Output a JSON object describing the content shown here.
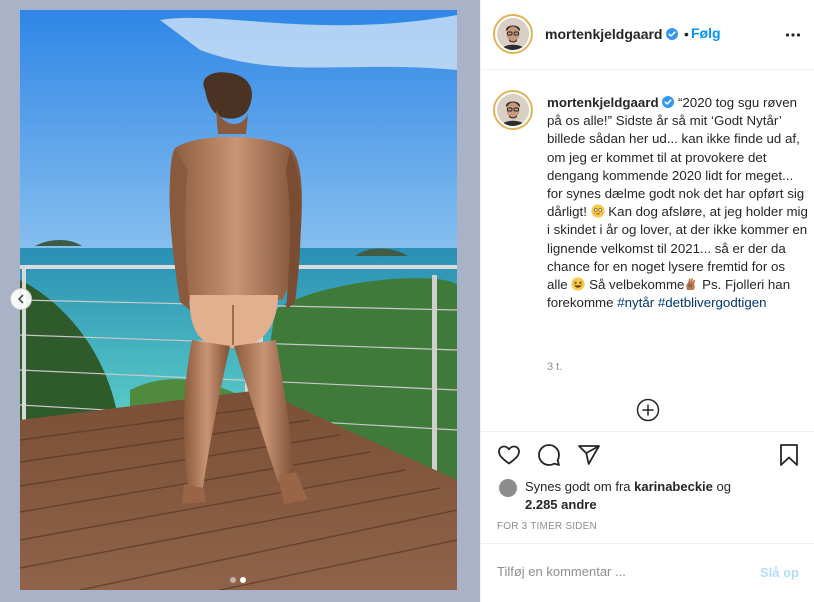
{
  "media": {
    "dots": [
      {
        "active": false
      },
      {
        "active": true
      }
    ],
    "prev_icon": "chevron-left-icon"
  },
  "header": {
    "username": "mortenkjeldgaard",
    "separator": "•",
    "follow_label": "Følg",
    "more_icon": "more-horizontal-icon",
    "verified_icon": "verified-badge-icon"
  },
  "caption": {
    "username": "mortenkjeldgaard",
    "text_1": " “2020 tog sgu røven på os alle!” Sidste år så mit ‘Godt Nytår’ billede sådan her ud... kan ikke finde ud af, om jeg er kommet til at provokere det dengang kommende 2020 lidt for meget... for synes dælme godt nok det har opført sig dårligt! ",
    "text_2": " Kan dog afsløre, at jeg holder mig i skindet i år og lover, at der ikke kommer en lignende velkomst til 2021... så er der da chance for en noget lysere fremtid for os alle ",
    "text_3": " Så velbekomme",
    "text_4": " Ps. Fjolleri han forekomme ",
    "hashtags": [
      "#nytår",
      "#detblivergodtigen"
    ],
    "emojis": [
      "flushed-face",
      "grinning-squinting-face",
      "ok-hand"
    ],
    "time": "3 t."
  },
  "actions": {
    "like_icon": "heart-icon",
    "comment_icon": "comment-icon",
    "share_icon": "paper-plane-icon",
    "save_icon": "bookmark-icon",
    "load_more_icon": "plus-circle-icon"
  },
  "likes": {
    "prefix": "Synes godt om fra ",
    "user": "karinabeckie",
    "conjunction": " og",
    "others": "2.285 andre"
  },
  "timestamp": "FOR 3 TIMER SIDEN",
  "comment": {
    "placeholder": "Tilføj en kommentar ...",
    "post_label": "Slå op"
  },
  "colors": {
    "accent": "#0095f6",
    "hashtag": "#00376b",
    "post_disabled": "#b2dffc",
    "muted": "#8e8e8e",
    "media_bg": "#a9b2c6"
  }
}
